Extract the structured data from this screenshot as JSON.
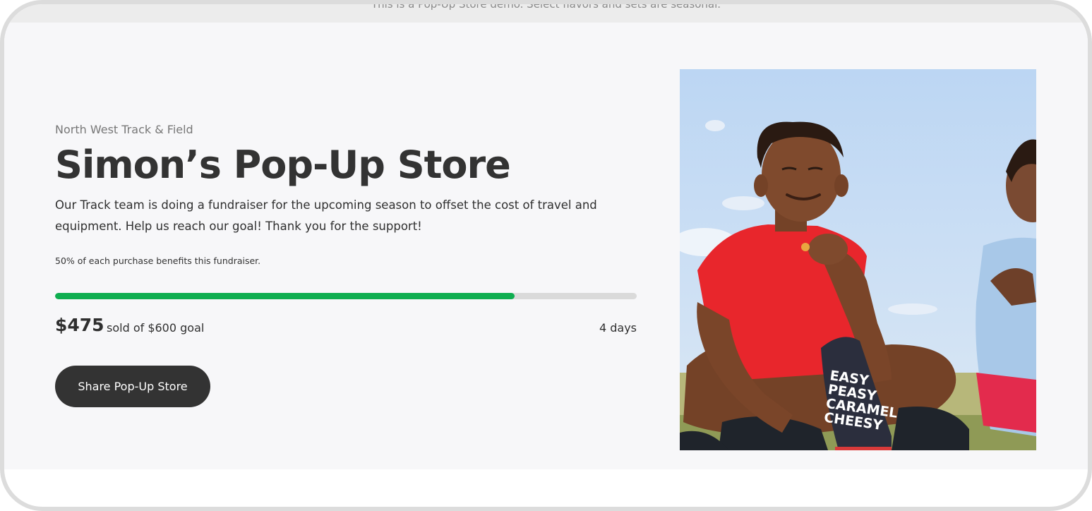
{
  "banner": {
    "text": "This is a Pop-Up Store demo. Select flavors and sets are seasonal."
  },
  "store": {
    "organization": "North West Track & Field",
    "title": "Simon’s Pop-Up Store",
    "description": "Our Track team is doing a fundraiser for the upcoming season to offset the cost of travel and equipment. Help us reach our goal! Thank you for the support!",
    "benefit_note": "50% of each purchase benefits this fundraiser."
  },
  "progress": {
    "sold": "$475",
    "goal_text": "sold of $600 goal",
    "fraction": 0.79,
    "time_left": "4 days"
  },
  "actions": {
    "share_label": "Share Pop-Up Store"
  },
  "photo": {
    "bag_text": "EASY PEASY CARAMEL CHEESY"
  },
  "colors": {
    "accent_green": "#0fae50",
    "button_dark": "#333333",
    "shirt_red": "#e8262c",
    "sky": "#c9def5"
  }
}
